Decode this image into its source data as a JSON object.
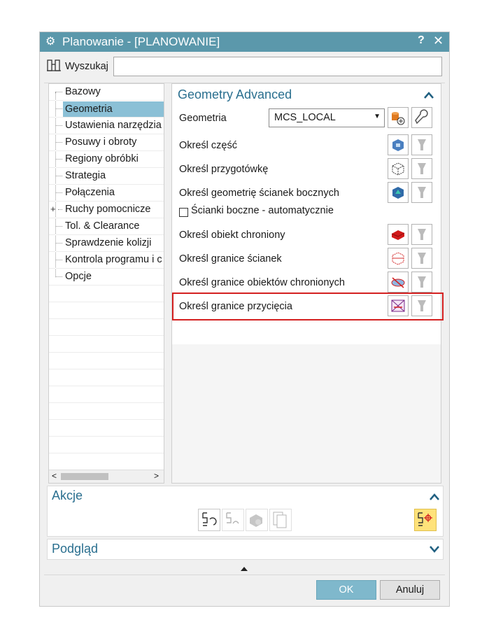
{
  "window": {
    "title": "Planowanie - [PLANOWANIE]",
    "help": "?",
    "close": "✕",
    "gear": "⚙"
  },
  "search": {
    "label": "Wyszukaj",
    "value": ""
  },
  "tree": {
    "items": [
      {
        "label": "Bazowy"
      },
      {
        "label": "Geometria"
      },
      {
        "label": "Ustawienia narzędzia"
      },
      {
        "label": "Posuwy i obroty"
      },
      {
        "label": "Regiony obróbki"
      },
      {
        "label": "Strategia"
      },
      {
        "label": "Połączenia"
      },
      {
        "label": "Ruchy pomocnicze"
      },
      {
        "label": "Tol. & Clearance"
      },
      {
        "label": "Sprawdzenie kolizji"
      },
      {
        "label": "Kontrola programu i c"
      },
      {
        "label": "Opcje"
      }
    ],
    "expander": "+",
    "scroll_left": "<",
    "scroll_right": ">"
  },
  "geometry": {
    "section_title": "Geometry Advanced",
    "geometry_label": "Geometria",
    "geometry_value": "MCS_LOCAL",
    "rows": [
      {
        "label": "Określ część"
      },
      {
        "label": "Określ przygotówkę"
      },
      {
        "label": "Określ geometrię ścianek bocznych"
      },
      {
        "label": "Określ obiekt chroniony"
      },
      {
        "label": "Określ granice ścianek"
      },
      {
        "label": "Określ granice obiektów chronionych"
      },
      {
        "label": "Określ granice przycięcia"
      }
    ],
    "checkbox_label": "Ścianki boczne - automatycznie",
    "checkbox_checked": false
  },
  "actions": {
    "title": "Akcje"
  },
  "preview": {
    "title": "Podgląd"
  },
  "footer": {
    "ok": "OK",
    "cancel": "Anuluj"
  },
  "colors": {
    "title_bar": "#5b98ab",
    "selected": "#8bc0d6",
    "accent_text": "#2a6f8f",
    "highlight_border": "#d42020",
    "ok_button": "#7fb8cc"
  }
}
